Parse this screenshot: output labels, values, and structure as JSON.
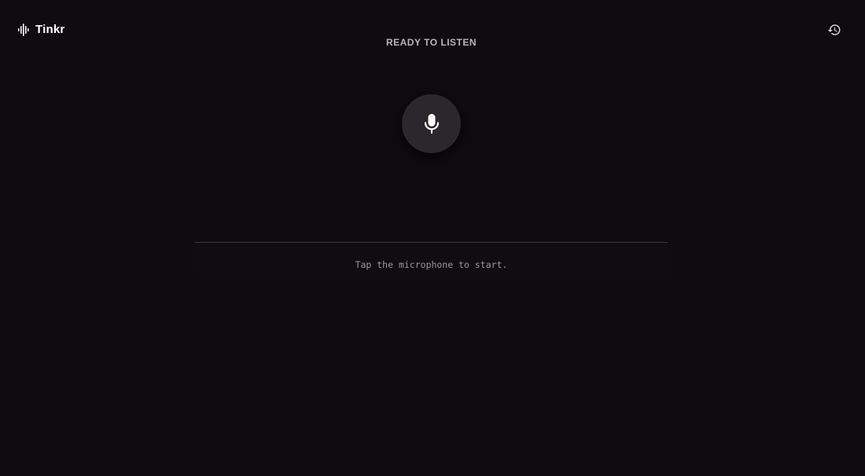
{
  "app": {
    "name": "Tinkr",
    "logo_icon": "audio-waveform-icon"
  },
  "status": {
    "text": "READY TO LISTEN"
  },
  "header": {
    "history_icon": "history-icon"
  },
  "recorder": {
    "mic_icon": "microphone-icon"
  },
  "transcript": {
    "hint": "Tap the microphone to start."
  },
  "colors": {
    "background": "#0e0c0f",
    "mic_button": "#2a282c",
    "status_text": "#b8b6ba",
    "hint_text": "#9a989c",
    "divider": "#3a383c",
    "foreground": "#ffffff"
  }
}
